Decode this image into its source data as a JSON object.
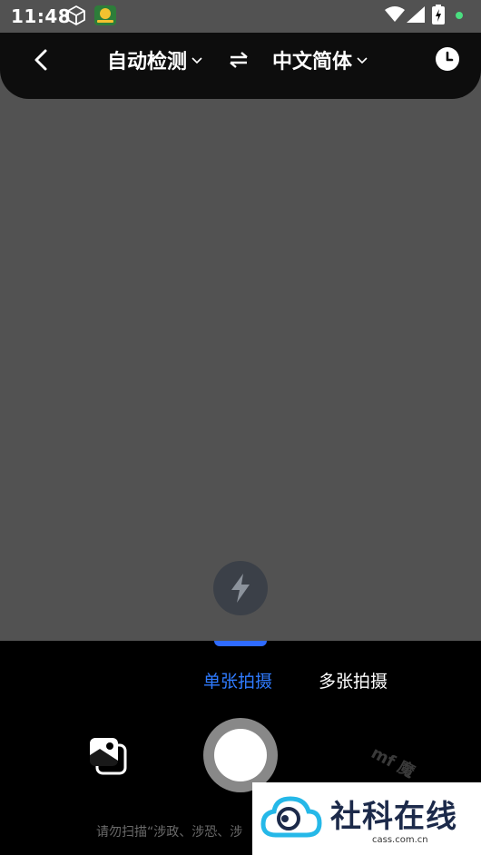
{
  "status_bar": {
    "time": "11:48",
    "icons": [
      "cube-icon",
      "app-icon",
      "wifi-icon",
      "signal-icon",
      "battery-icon",
      "notification-dot-icon"
    ]
  },
  "top_bar": {
    "source_language": "自动检测",
    "target_language": "中文简体",
    "icons": [
      "back-icon",
      "swap-icon",
      "history-icon",
      "chevron-down-icon"
    ]
  },
  "camera": {
    "flash_icon": "flash-icon"
  },
  "modes": {
    "single": "单张拍摄",
    "multi": "多张拍摄",
    "active": "single",
    "active_color": "#2f7bff"
  },
  "controls": {
    "gallery_icon": "gallery-icon",
    "shutter": "shutter-button"
  },
  "notice": "请勿扫描“涉政、涉恐、涉",
  "watermark": {
    "faint_text": "mf 魔",
    "title": "社科在线",
    "domain": "cass.com.cn"
  },
  "colors": {
    "accent": "#2f7bff",
    "preview": "#525252",
    "top_bar": "#0d0d0d"
  }
}
